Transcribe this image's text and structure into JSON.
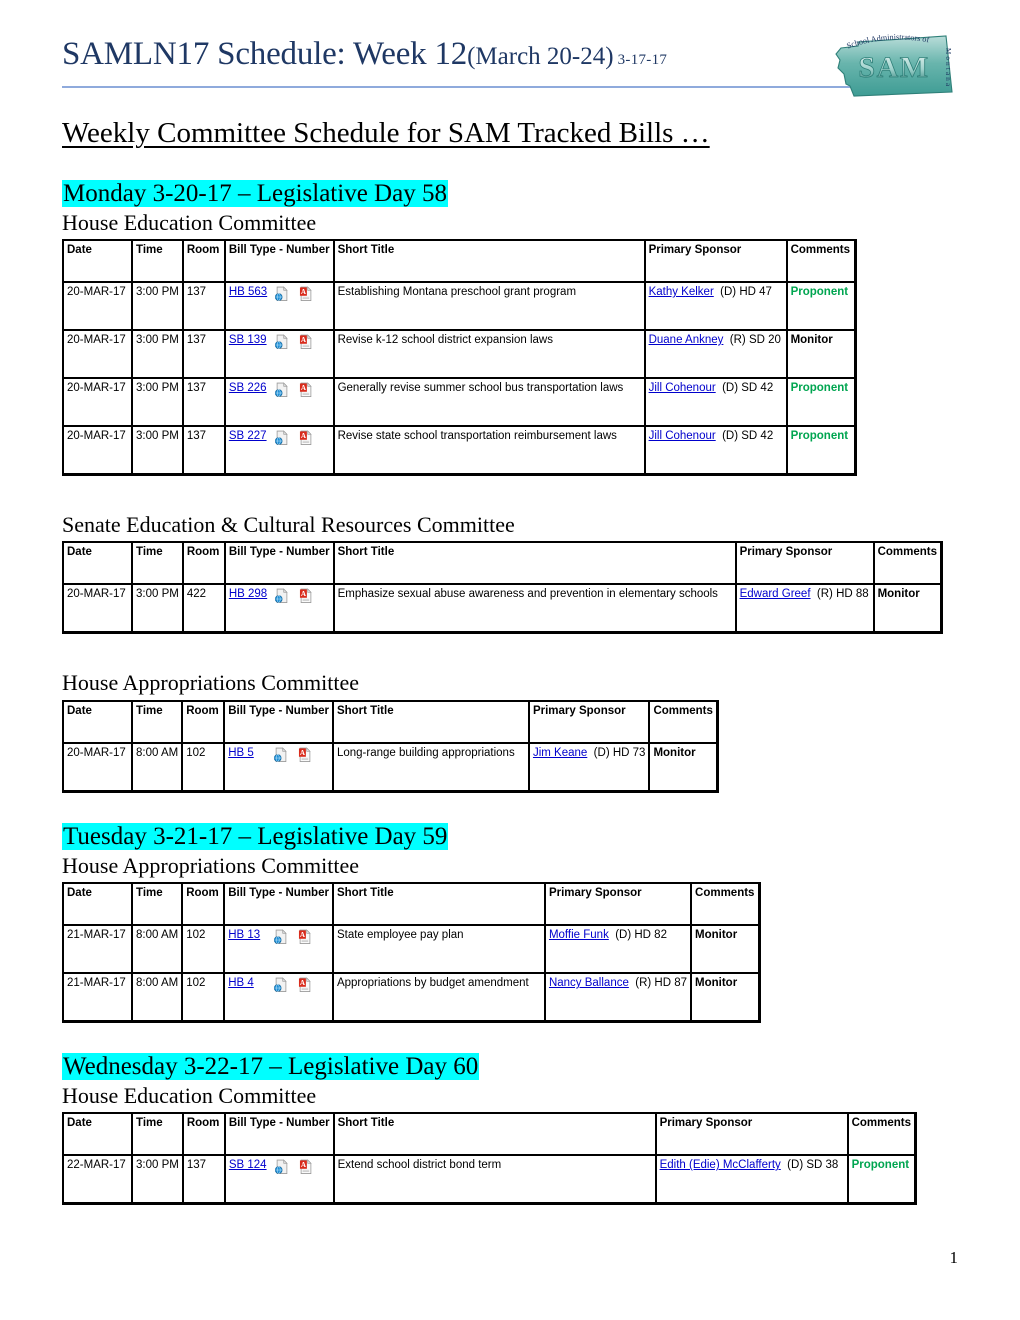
{
  "header": {
    "title_main": "SAMLN17 Schedule: Week 12",
    "title_paren": "(March 20-24)",
    "title_date": "3-17-17",
    "logo": {
      "arc_text": "School Administrators of",
      "acronym": "SAM",
      "vertical_text": "Montana",
      "color": "#3E9C94"
    }
  },
  "subtitle": "Weekly Committee Schedule for SAM Tracked Bills …",
  "columns": [
    "Date",
    "Time",
    "Room",
    "Bill Type - Number",
    "Short Title",
    "Primary Sponsor",
    "Comments"
  ],
  "highlight_color": "#00FFFF",
  "accent_color": "#1F3864",
  "rule_color": "#8FAADC",
  "comment_proponent_color": "#00A550",
  "days": [
    {
      "label": "Monday 3-20-17 – Legislative Day 58",
      "committees": [
        {
          "name": "House Education Committee",
          "rows": [
            {
              "date": "20-MAR-17",
              "time": "3:00 PM",
              "room": "137",
              "bill": "HB 563",
              "title": "Establishing Montana preschool grant program",
              "sponsor": "Kathy Kelker",
              "sponsor_meta": "(D) HD 47",
              "comment": "Proponent",
              "comment_type": "proponent"
            },
            {
              "date": "20-MAR-17",
              "time": "3:00 PM",
              "room": "137",
              "bill": "SB 139",
              "title": "Revise k-12 school district expansion laws",
              "sponsor": "Duane Ankney",
              "sponsor_meta": "(R) SD 20",
              "comment": "Monitor",
              "comment_type": "monitor"
            },
            {
              "date": "20-MAR-17",
              "time": "3:00 PM",
              "room": "137",
              "bill": "SB 226",
              "title": "Generally revise summer school bus transportation laws",
              "sponsor": "Jill Cohenour",
              "sponsor_meta": "(D) SD 42",
              "comment": "Proponent",
              "comment_type": "proponent"
            },
            {
              "date": "20-MAR-17",
              "time": "3:00 PM",
              "room": "137",
              "bill": "SB 227",
              "title": "Revise state school transportation reimbursement laws",
              "sponsor": "Jill Cohenour",
              "sponsor_meta": "(D) SD 42",
              "comment": "Proponent",
              "comment_type": "proponent"
            }
          ]
        },
        {
          "name": "Senate Education & Cultural Resources Committee",
          "rows": [
            {
              "date": "20-MAR-17",
              "time": "3:00 PM",
              "room": "422",
              "bill": "HB 298",
              "title": "Emphasize sexual abuse awareness and prevention in elementary schools",
              "sponsor": "Edward Greef",
              "sponsor_meta": "(R) HD 88",
              "comment": "Monitor",
              "comment_type": "monitor"
            }
          ]
        },
        {
          "name": "House Appropriations Committee",
          "rows": [
            {
              "date": "20-MAR-17",
              "time": "8:00 AM",
              "room": "102",
              "bill": "HB 5",
              "title": "Long-range building appropriations",
              "sponsor": "Jim Keane",
              "sponsor_meta": "(D) HD 73",
              "comment": "Monitor",
              "comment_type": "monitor"
            }
          ]
        }
      ]
    },
    {
      "label": "Tuesday 3-21-17 – Legislative Day 59",
      "committees": [
        {
          "name": "House Appropriations Committee",
          "rows": [
            {
              "date": "21-MAR-17",
              "time": "8:00 AM",
              "room": "102",
              "bill": "HB 13",
              "title": "State employee pay plan",
              "sponsor": "Moffie Funk",
              "sponsor_meta": "(D) HD 82",
              "comment": "Monitor",
              "comment_type": "monitor"
            },
            {
              "date": "21-MAR-17",
              "time": "8:00 AM",
              "room": "102",
              "bill": "HB 4",
              "title": "Appropriations by budget amendment",
              "sponsor": "Nancy Ballance",
              "sponsor_meta": "(R) HD 87",
              "comment": "Monitor",
              "comment_type": "monitor"
            }
          ]
        }
      ]
    },
    {
      "label": "Wednesday 3-22-17 – Legislative Day 60",
      "committees": [
        {
          "name": "House Education Committee",
          "rows": [
            {
              "date": "22-MAR-17",
              "time": "3:00 PM",
              "room": "137",
              "bill": "SB 124",
              "title": "Extend school district bond term",
              "sponsor": "Edith (Edie) McClafferty",
              "sponsor_meta": "(D) SD 38",
              "comment": "Proponent",
              "comment_type": "proponent"
            }
          ]
        }
      ]
    }
  ],
  "icons": {
    "html_doc": "html-document-icon",
    "pdf_doc": "pdf-document-icon"
  },
  "page_number": "1"
}
